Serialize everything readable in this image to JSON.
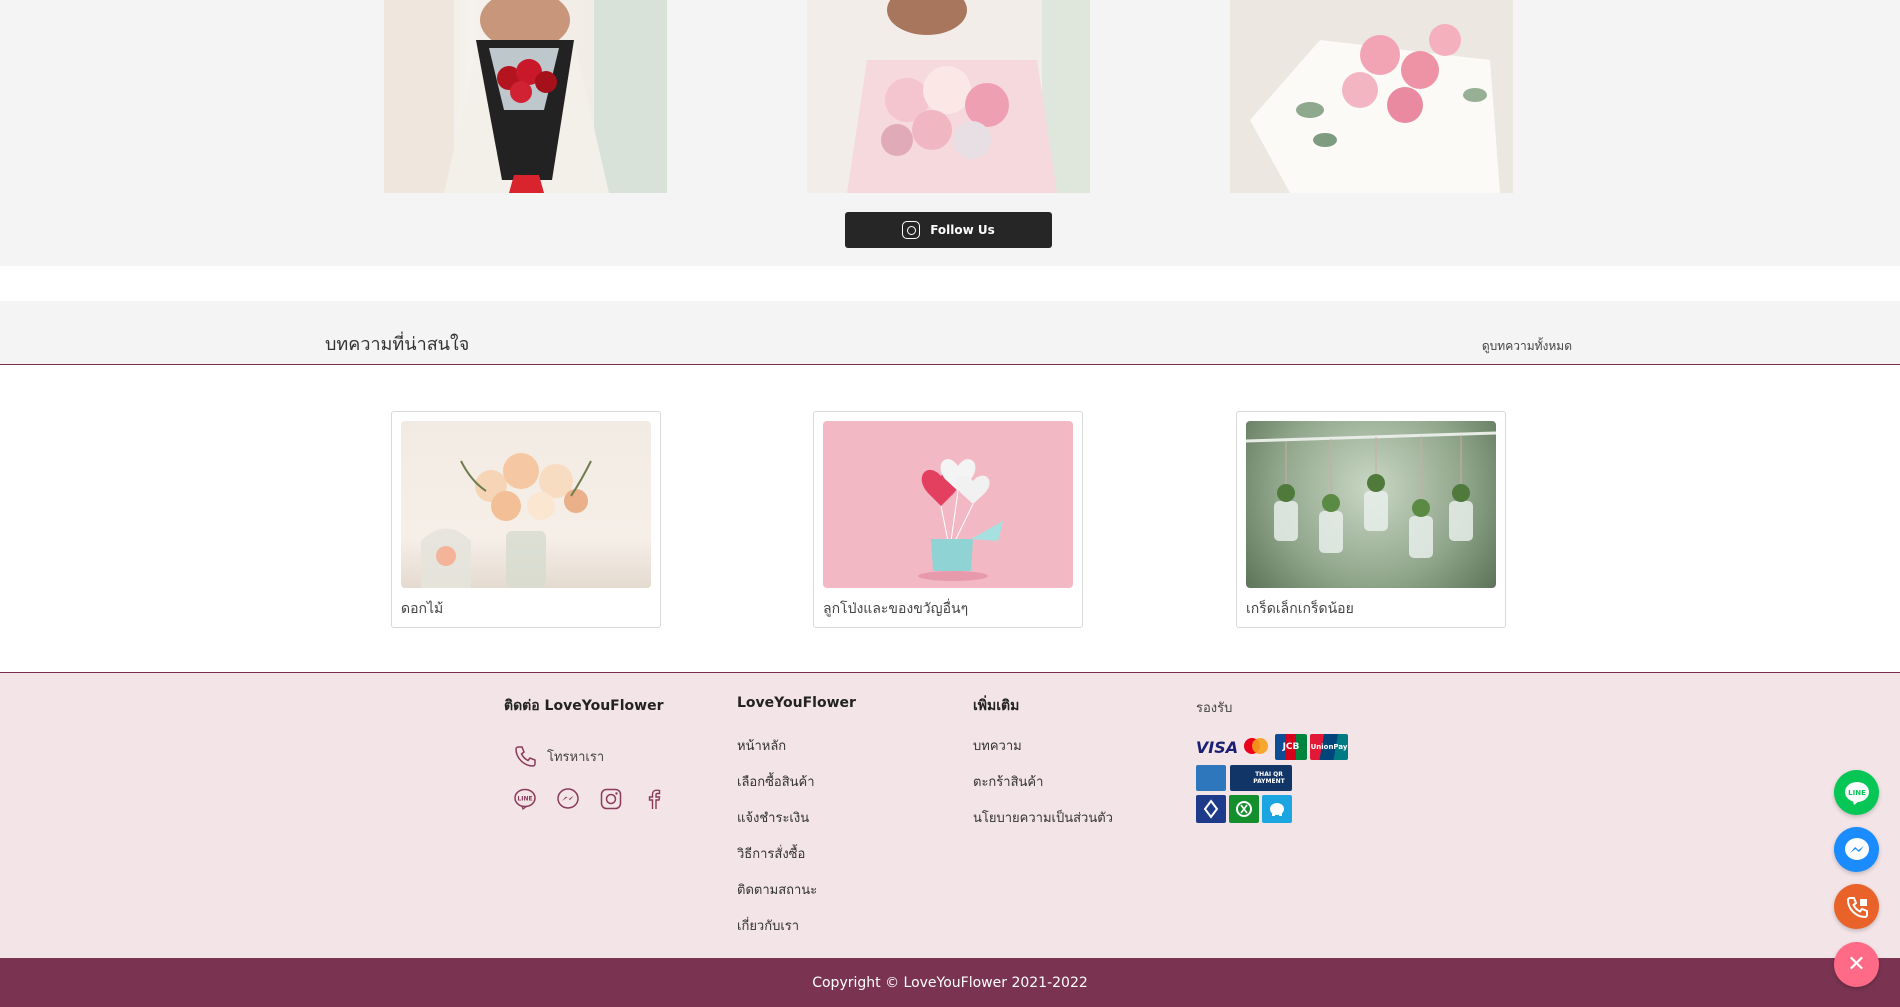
{
  "instagram": {
    "follow_label": "Follow Us",
    "icon": "instagram-icon"
  },
  "articles": {
    "title": "บทความที่น่าสนใจ",
    "view_all": "ดูบทความทั้งหมด",
    "cards": [
      {
        "caption": "ดอกไม้"
      },
      {
        "caption": "ลูกโป่งและของขวัญอื่นๆ"
      },
      {
        "caption": "เกร็ดเล็กเกร็ดน้อย"
      }
    ]
  },
  "footer": {
    "contact": {
      "title": "ติดต่อ LoveYouFlower",
      "phone_label": "โทรหาเรา",
      "socials": [
        "line-icon",
        "messenger-icon",
        "instagram-icon",
        "facebook-icon"
      ]
    },
    "brand": {
      "title": "LoveYouFlower",
      "links": [
        "หน้าหลัก",
        "เลือกซื้อสินค้า",
        "แจ้งชำระเงิน",
        "วิธีการสั่งซื้อ",
        "ติดตามสถานะ",
        "เกี่ยวกับเรา"
      ]
    },
    "more": {
      "title": "เพิ่มเติม",
      "links": [
        "บทความ",
        "ตะกร้าสินค้า",
        "นโยบายความเป็นส่วนตัว"
      ]
    },
    "payments": {
      "title": "รองรับ",
      "row1": [
        "VISA",
        "JCB",
        "UnionPay"
      ],
      "row2": [
        "THAI QR PAYMENT"
      ]
    }
  },
  "copyright": "Copyright © LoveYouFlower 2021-2022",
  "colors": {
    "brand": "#7a3451",
    "footer_bg": "#f3e4e7",
    "line_green": "#06c755",
    "messenger_blue": "#1a8cff",
    "call_orange": "#e8622a",
    "close_pink": "#ff6b86"
  }
}
